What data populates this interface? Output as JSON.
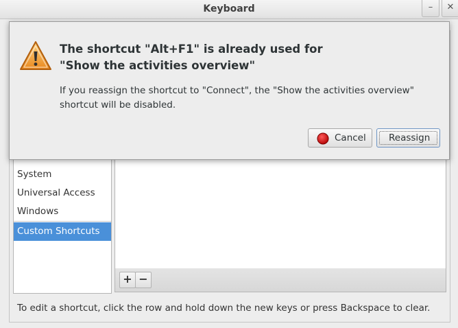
{
  "window": {
    "title": "Keyboard",
    "minimize": "–",
    "close": "✕"
  },
  "sidebar": {
    "items": [
      "System",
      "Universal Access",
      "Windows"
    ],
    "selected": "Custom Shortcuts"
  },
  "toolbar": {
    "add": "+",
    "remove": "−"
  },
  "hint": "To edit a shortcut, click the row and hold down the new keys or press Backspace to clear.",
  "dialog": {
    "heading_line1": "The shortcut \"Alt+F1\" is already used for",
    "heading_line2": "\"Show the activities overview\"",
    "body_line1": "If you reassign the shortcut to \"Connect\", the \"Show the activities overview\"",
    "body_line2": "shortcut will be disabled.",
    "cancel_label": "Cancel",
    "reassign_label": "Reassign",
    "warning_icon": "warning-icon",
    "cancel_icon": "stop-icon"
  },
  "colors": {
    "selection": "#4a90d9",
    "warning": "#f0a13a",
    "stop": "#cc0000"
  }
}
